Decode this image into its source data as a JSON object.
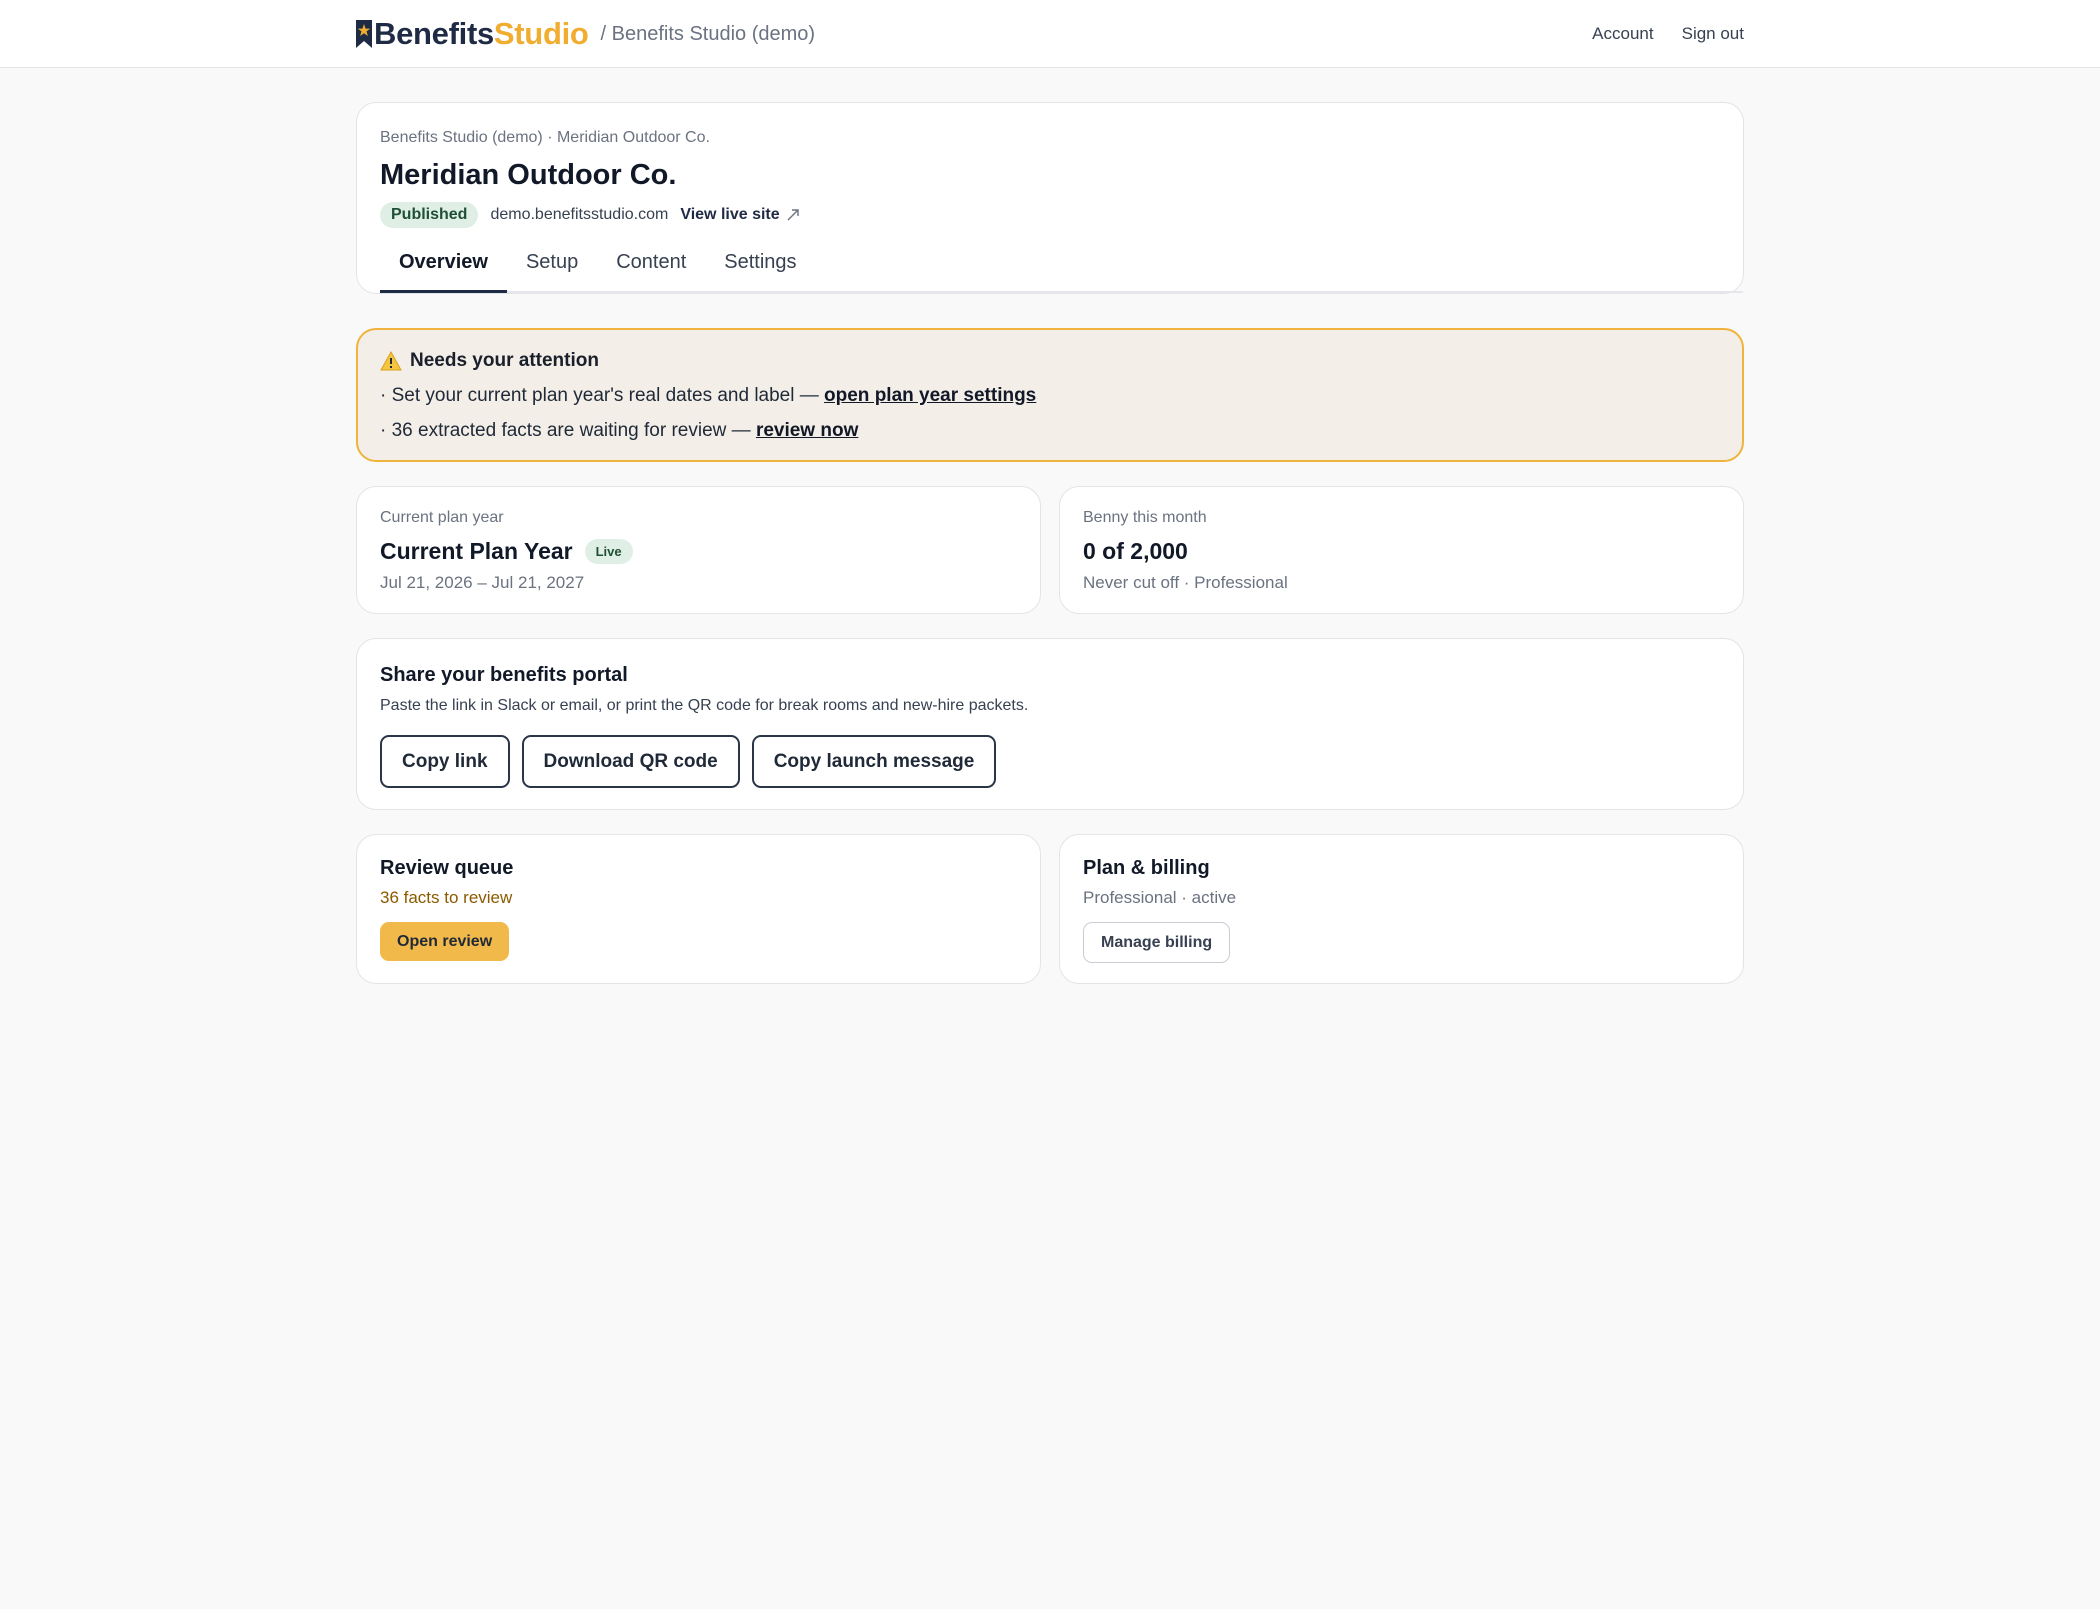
{
  "topbar": {
    "logo_part1": "Benefits",
    "logo_part2": "Studio",
    "crumb": "/ Benefits Studio (demo)",
    "account_label": "Account",
    "signout_label": "Sign out"
  },
  "header": {
    "breadcrumb": "Benefits Studio (demo) · Meridian Outdoor Co.",
    "title": "Meridian Outdoor Co.",
    "status": "Published",
    "domain": "demo.benefitsstudio.com",
    "live_link": "View live site",
    "tabs": [
      {
        "label": "Overview",
        "active": true
      },
      {
        "label": "Setup"
      },
      {
        "label": "Content"
      },
      {
        "label": "Settings"
      }
    ]
  },
  "alert": {
    "title": "Needs your attention",
    "line1_text": "· Set your current plan year's real dates and label — ",
    "line1_link": "open plan year settings",
    "line2_text": "· 36 extracted facts are waiting for review — ",
    "line2_link": "review now"
  },
  "plan_year": {
    "label": "Current plan year",
    "title": "Current Plan Year",
    "badge": "Live",
    "dates": "Jul 21, 2026 – Jul 21, 2027"
  },
  "benny": {
    "label": "Benny this month",
    "value": "0 of 2,000",
    "sub": "Never cut off · Professional"
  },
  "share": {
    "title": "Share your benefits portal",
    "desc": "Paste the link in Slack or email, or print the QR code for break rooms and new-hire packets.",
    "copy_link": "Copy link",
    "download_qr": "Download QR code",
    "copy_message": "Copy launch message"
  },
  "review": {
    "title": "Review queue",
    "sub": "36 facts to review",
    "button": "Open review"
  },
  "billing": {
    "title": "Plan & billing",
    "sub": "Professional · active",
    "button": "Manage billing"
  },
  "colors": {
    "brand_navy": "#1f2a44",
    "brand_gold": "#f0ad30",
    "alert_border": "#f0b33e",
    "alert_bg": "#f3eee7",
    "published_bg": "#e0efe5"
  }
}
